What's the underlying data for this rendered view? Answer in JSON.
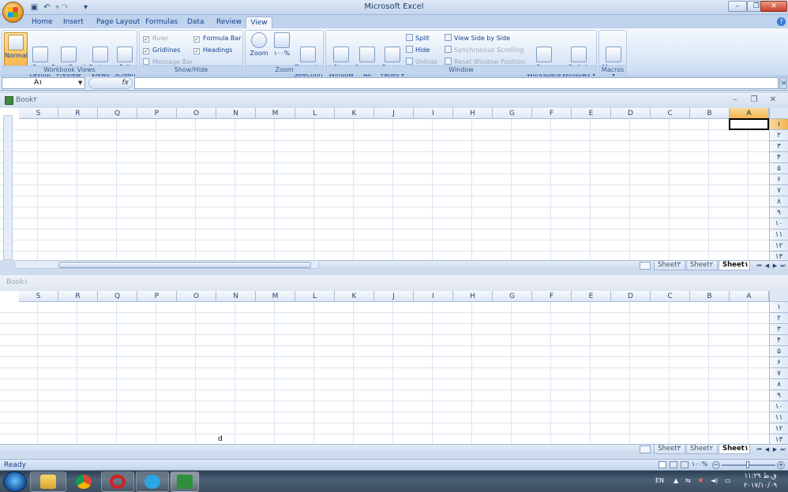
{
  "app": {
    "title": "Microsoft Excel",
    "minimize": "–",
    "restore": "❐",
    "close": "✕"
  },
  "qat": {
    "save_icon": "floppy-icon",
    "undo_icon": "undo-icon",
    "redo_icon": "redo-icon"
  },
  "ribbon_tabs": [
    "Home",
    "Insert",
    "Page Layout",
    "Formulas",
    "Data",
    "Review",
    "View"
  ],
  "active_tab": "View",
  "workbook_views": {
    "label": "Workbook Views",
    "buttons": [
      {
        "label": "Normal"
      },
      {
        "label": "Page\nLayout"
      },
      {
        "label": "Page Break\nPreview"
      },
      {
        "label": "Custom\nViews"
      },
      {
        "label": "Full\nScreen"
      }
    ]
  },
  "show_hide": {
    "label": "Show/Hide",
    "ruler": "Ruler",
    "gridlines": "Gridlines",
    "message_bar": "Message Bar",
    "formula_bar": "Formula Bar",
    "headings": "Headings",
    "checked": {
      "ruler": true,
      "gridlines": true,
      "message_bar": false,
      "formula_bar": true,
      "headings": true
    }
  },
  "zoom": {
    "label": "Zoom",
    "zoom_btn": "Zoom",
    "hundred_btn": "۱۰۰%",
    "zoom_selection_btn": "Zoom to\nSelection"
  },
  "window": {
    "label": "Window",
    "new_window": "New\nWindow",
    "arrange_all": "Arrange\nAll",
    "freeze_panes": "Freeze\nPanes ▾",
    "split": "Split",
    "hide": "Hide",
    "unhide": "Unhide",
    "view_side_by_side": "View Side by Side",
    "sync_scrolling": "Synchronous Scrolling",
    "reset_position": "Reset Window Position",
    "save_workspace": "Save\nWorkspace",
    "switch_windows": "Switch\nWindows ▾"
  },
  "macros": {
    "label": "Macros",
    "button": "Macros\n▾"
  },
  "formula_bar": {
    "name_box": "A۱",
    "fx": "fx",
    "value": ""
  },
  "columns": [
    "S",
    "R",
    "Q",
    "P",
    "O",
    "N",
    "M",
    "L",
    "K",
    "J",
    "I",
    "H",
    "G",
    "F",
    "E",
    "D",
    "C",
    "B",
    "A"
  ],
  "rows": [
    "۱",
    "۲",
    "۳",
    "۴",
    "۵",
    "۶",
    "۷",
    "۸",
    "۹",
    "۱۰",
    "۱۱",
    "۱۲",
    "۱۳"
  ],
  "window1": {
    "title": "Book۲",
    "selected_col": "A",
    "selected_row": "۱"
  },
  "window2": {
    "title": "Book۱",
    "cell_text": "d"
  },
  "sheet_tabs": [
    "Sheet۳",
    "Sheet۲",
    "Sheet۱"
  ],
  "active_sheet": "Sheet۱",
  "status": {
    "text": "Ready",
    "zoom": "۱۰۰%"
  },
  "taskbar": {
    "apps": [
      "explorer-icon",
      "chrome-icon",
      "opera-icon",
      "telegram-icon",
      "excel-icon"
    ],
    "language": "EN",
    "time": "ق.ظ ۱۱:۲۹",
    "date": "۲۰۱۷/۱۰/۰۹"
  }
}
